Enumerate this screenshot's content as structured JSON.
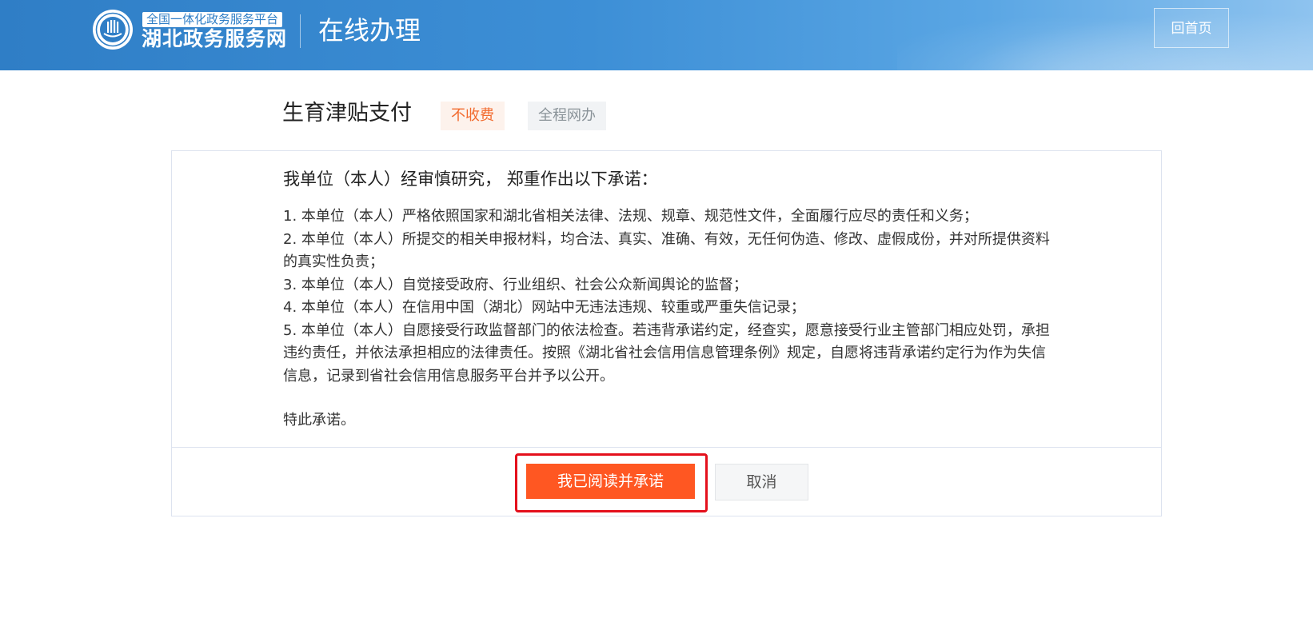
{
  "header": {
    "logo_top": "全国一体化政务服务平台",
    "logo_main": "湖北政务服务网",
    "title": "在线办理",
    "home_button": "回首页"
  },
  "service": {
    "title": "生育津贴支付",
    "tags": [
      "不收费",
      "全程网办"
    ]
  },
  "commitment": {
    "heading": "我单位（本人）经审慎研究， 郑重作出以下承诺：",
    "items": [
      "1. 本单位（本人）严格依照国家和湖北省相关法律、法规、规章、规范性文件，全面履行应尽的责任和义务；",
      "2. 本单位（本人）所提交的相关申报材料，均合法、真实、准确、有效，无任何伪造、修改、虚假成份，并对所提供资料的真实性负责；",
      "3. 本单位（本人）自觉接受政府、行业组织、社会公众新闻舆论的监督；",
      "4. 本单位（本人）在信用中国（湖北）网站中无违法违规、较重或严重失信记录；",
      "5. 本单位（本人）自愿接受行政监督部门的依法检查。若违背承诺约定，经查实，愿意接受行业主管部门相应处罚，承担违约责任，并依法承担相应的法律责任。按照《湖北省社会信用信息管理条例》规定，自愿将违背承诺约定行为作为失信信息，记录到省社会信用信息服务平台并予以公开。"
    ],
    "closing": "特此承诺。"
  },
  "actions": {
    "confirm": "我已阅读并承诺",
    "cancel": "取消"
  },
  "colors": {
    "header_blue": "#2f7ec6",
    "primary_orange": "#ff5722",
    "highlight_red": "#e4101c",
    "free_tag_text": "#f26a2d"
  }
}
